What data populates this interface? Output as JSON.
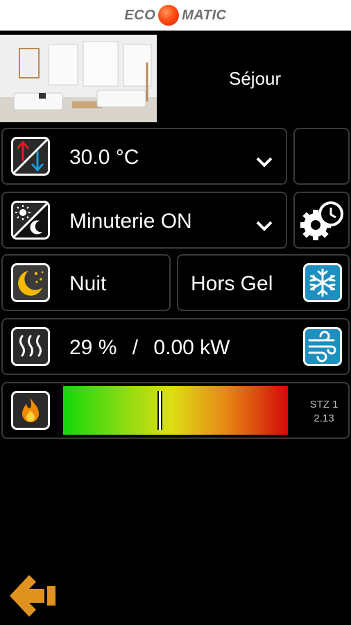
{
  "header": {
    "logo_left": "ECO",
    "logo_right": "MATIC"
  },
  "room": {
    "name": "Séjour"
  },
  "temperature": {
    "value": "30.0 °C",
    "icon": "thermo-up-down-icon"
  },
  "timer": {
    "value": "Minuterie ON",
    "icon": "day-night-icon",
    "settings_icon": "gear-clock-icon"
  },
  "modes": {
    "night": {
      "label": "Nuit",
      "icon": "moon-stars-icon"
    },
    "frost": {
      "label": "Hors Gel",
      "icon": "snowflake-icon"
    }
  },
  "power": {
    "percent": "29 %",
    "separator": "/",
    "kw": "0.00 kW",
    "icon": "heat-waves-icon",
    "fan_icon": "wind-icon"
  },
  "level": {
    "icon": "flame-icon",
    "marker_fraction": 0.43,
    "device": "STZ 1",
    "version": "2.13"
  },
  "colors": {
    "accent_orange": "#e0921e",
    "border": "#3a3a3a",
    "blue": "#1e8fc0"
  },
  "nav": {
    "back_icon": "arrow-left-icon"
  }
}
